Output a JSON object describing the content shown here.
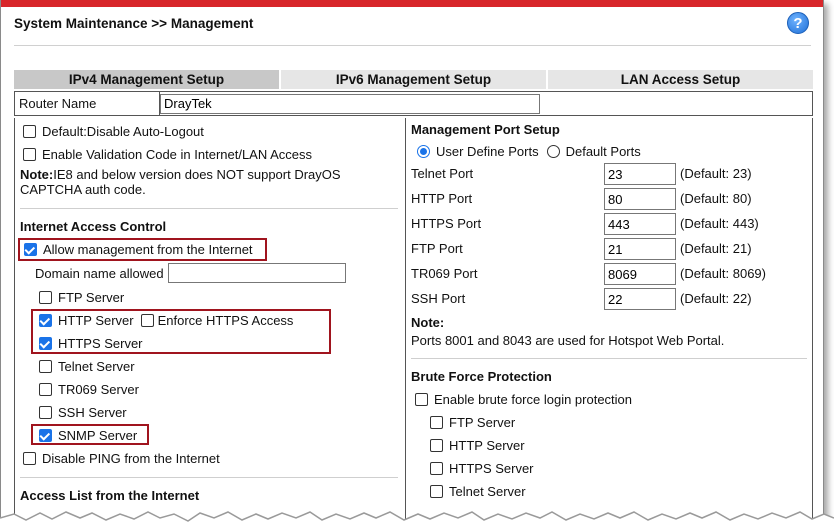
{
  "header": {
    "title": "System Maintenance >> Management",
    "help": "?"
  },
  "tabs": [
    {
      "label": "IPv4 Management Setup",
      "active": true
    },
    {
      "label": "IPv6 Management Setup",
      "active": false
    },
    {
      "label": "LAN Access Setup",
      "active": false
    }
  ],
  "router_name": {
    "label": "Router Name",
    "value": "DrayTek"
  },
  "left": {
    "auto_logout": "Default:Disable Auto-Logout",
    "validation_code": "Enable Validation Code in Internet/LAN Access",
    "note_label": "Note:",
    "note_text1": " IE8 and below version does NOT support DrayOS",
    "note_text2": "CAPTCHA auth code.",
    "iac_title": "Internet Access Control",
    "allow_mgmt": "Allow management from the Internet",
    "domain_label": "Domain name allowed",
    "domain_value": "",
    "ftp": "FTP Server",
    "http": "HTTP Server",
    "enforce_https": "Enforce HTTPS Access",
    "https": "HTTPS Server",
    "telnet": "Telnet Server",
    "tr069": "TR069 Server",
    "ssh": "SSH Server",
    "snmp": "SNMP Server",
    "disable_ping": "Disable PING from the Internet",
    "acl_title": "Access List from the Internet"
  },
  "right": {
    "mps_title": "Management Port Setup",
    "user_define": "User Define Ports",
    "default_ports": "Default Ports",
    "ports": [
      {
        "label": "Telnet Port",
        "value": "23",
        "default": "(Default: 23)"
      },
      {
        "label": "HTTP Port",
        "value": "80",
        "default": "(Default: 80)"
      },
      {
        "label": "HTTPS Port",
        "value": "443",
        "default": "(Default: 443)"
      },
      {
        "label": "FTP Port",
        "value": "21",
        "default": "(Default: 21)"
      },
      {
        "label": "TR069 Port",
        "value": "8069",
        "default": "(Default: 8069)"
      },
      {
        "label": "SSH Port",
        "value": "22",
        "default": "(Default: 22)"
      }
    ],
    "note_label": "Note:",
    "note_text": "Ports 8001 and 8043 are used for Hotspot Web Portal.",
    "bfp_title": "Brute Force Protection",
    "bfp_enable": "Enable brute force login protection",
    "bfp_ftp": "FTP Server",
    "bfp_http": "HTTP Server",
    "bfp_https": "HTTPS Server",
    "bfp_telnet": "Telnet Server"
  },
  "colors": {
    "accent": "#d8262a",
    "checkbox": "#1a73e8",
    "highlight": "#a0141e"
  }
}
